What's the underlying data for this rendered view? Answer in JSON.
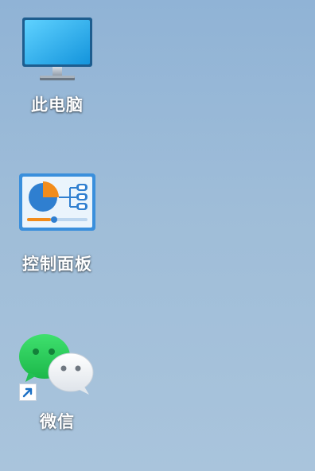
{
  "desktop": {
    "icons": [
      {
        "label": "此电脑",
        "icon": "computer-monitor-icon"
      },
      {
        "label": "控制面板",
        "icon": "control-panel-icon"
      },
      {
        "label": "微信",
        "icon": "wechat-icon",
        "shortcut": true
      }
    ]
  },
  "colors": {
    "desktop_background_top": "#90b3d6",
    "desktop_background_bottom": "#a9c4dc",
    "monitor_screen": "#2fb3ef",
    "control_panel_blue": "#3a8fdc",
    "control_panel_orange": "#f28c1b",
    "wechat_green": "#2fd35f",
    "wechat_white_bubble": "#f3f5f7"
  }
}
